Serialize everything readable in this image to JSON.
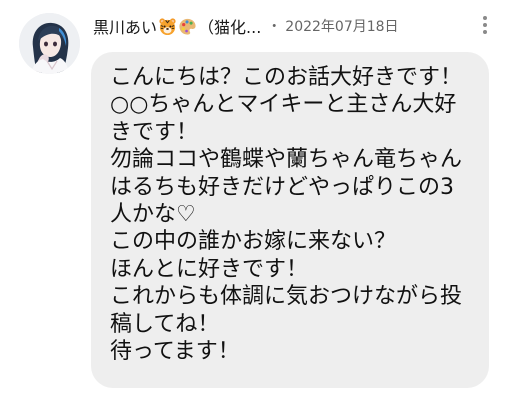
{
  "comment": {
    "author": {
      "name": "黒川あい",
      "name_suffix": "（猫化...",
      "emoji_icons": [
        "tiger-face-icon",
        "artist-palette-icon"
      ]
    },
    "separator": "・",
    "date": "2022年07月18日",
    "message_lines": [
      "こんにちは？このお話大好きです！",
      "○○ちゃんとマイキーと主さん大好",
      "きです！",
      "勿論ココや鶴蝶や蘭ちゃん竜ちゃん",
      "はるちも好きだけどやっぱりこの3",
      "人かな♡",
      "この中の誰かお嫁に来ない？",
      "ほんとに好きです！",
      "これからも体調に気おつけながら投",
      "稿してね！",
      "待ってます！"
    ]
  },
  "colors": {
    "bubble_background": "#eeeeee",
    "text_primary": "#111111",
    "text_secondary": "#666666",
    "page_background": "#ffffff"
  },
  "icons": {
    "more_menu": "vertical-ellipsis-icon"
  }
}
